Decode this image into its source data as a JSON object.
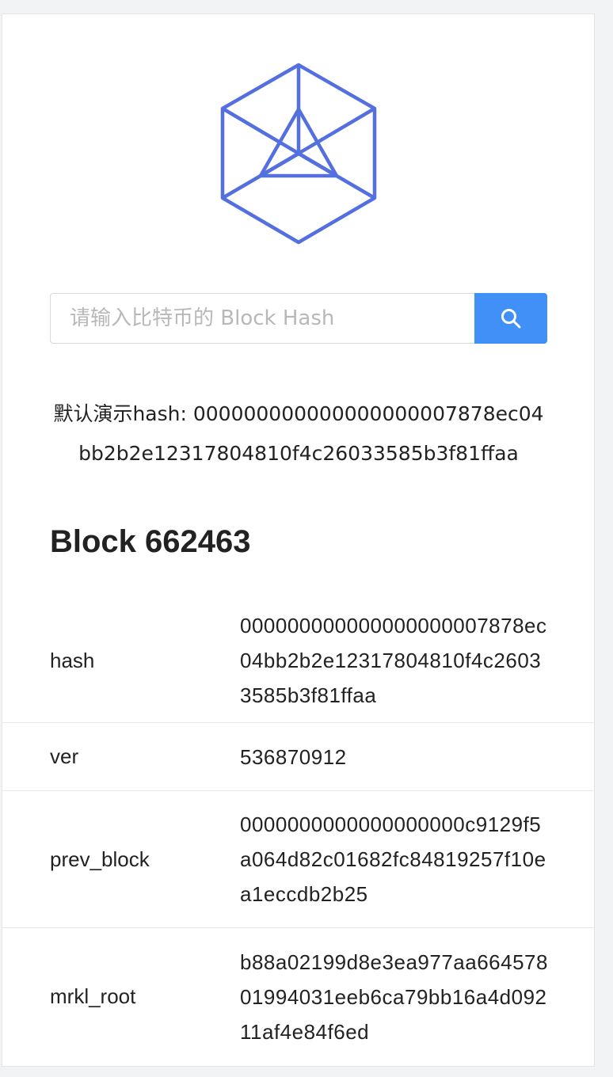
{
  "logo": {
    "icon": "hexagon-cube-logo-icon",
    "color": "#5470e0"
  },
  "search": {
    "placeholder": "请输入比特币的 Block Hash",
    "value": "",
    "button_icon": "search-icon",
    "button_color": "#4090f7"
  },
  "demo": {
    "label": "默认演示hash: ",
    "hash": "000000000000000000007878ec04bb2b2e12317804810f4c26033585b3f81ffaa"
  },
  "block": {
    "title": "Block 662463",
    "fields": [
      {
        "key": "hash",
        "value": "000000000000000000007878ec04bb2b2e12317804810f4c26033585b3f81ffaa"
      },
      {
        "key": "ver",
        "value": "536870912"
      },
      {
        "key": "prev_block",
        "value": "0000000000000000000c9129f5a064d82c01682fc84819257f10ea1eccdb2b25"
      },
      {
        "key": "mrkl_root",
        "value": "b88a02199d8e3ea977aa66457801994031eeb6ca79bb16a4d09211af4e84f6ed"
      }
    ]
  }
}
